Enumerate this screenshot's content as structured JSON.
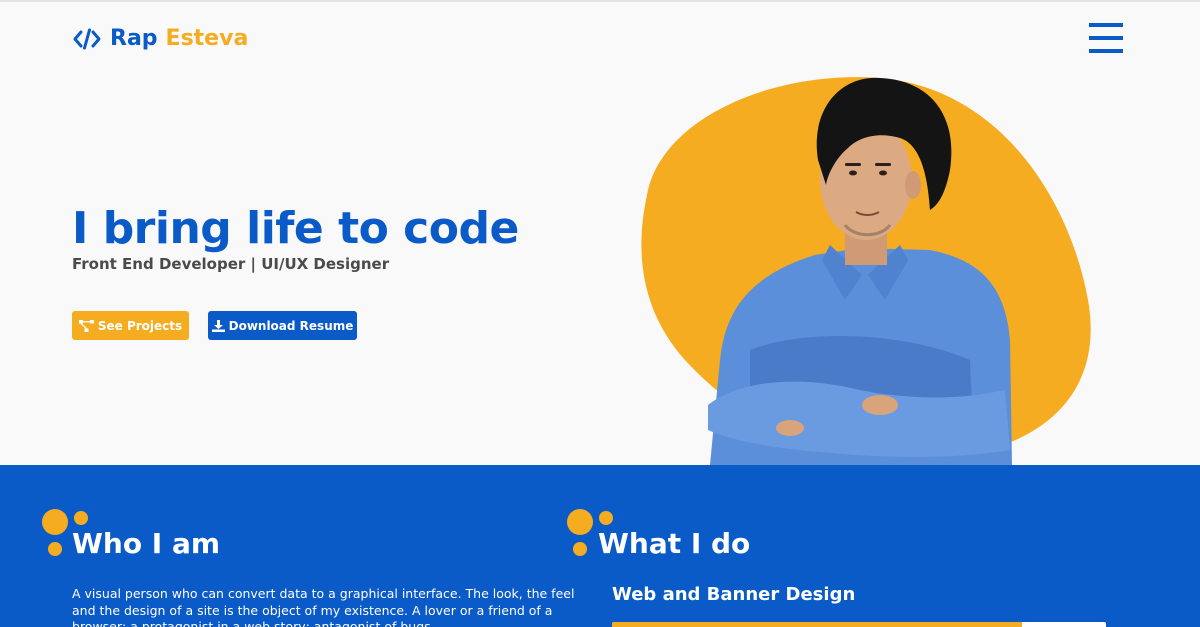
{
  "header": {
    "logo_first": "Rap",
    "logo_last": "Esteva",
    "logo_icon": "code-brackets-icon",
    "menu_icon": "hamburger-menu-icon"
  },
  "hero": {
    "title": "I bring life to code",
    "subtitle": "Front End Developer | UI/UX Designer",
    "buttons": {
      "projects_label": "See Projects",
      "projects_icon": "sitemap-icon",
      "resume_label": "Download Resume",
      "resume_icon": "download-icon"
    }
  },
  "about": {
    "heading": "Who I am",
    "text": "A visual person who can convert data to a graphical interface. The look, the feel and the design of a site is the object of my existence. A lover or a friend of a browser; a protagonist in a web story; antagonist of bugs."
  },
  "services": {
    "heading": "What I do",
    "items": [
      {
        "title": "Web and Banner Design",
        "level": 0.83
      }
    ]
  },
  "colors": {
    "brand_blue": "#0a5ac7",
    "accent_yellow": "#f5ac21",
    "background": "#f9f9f9"
  }
}
